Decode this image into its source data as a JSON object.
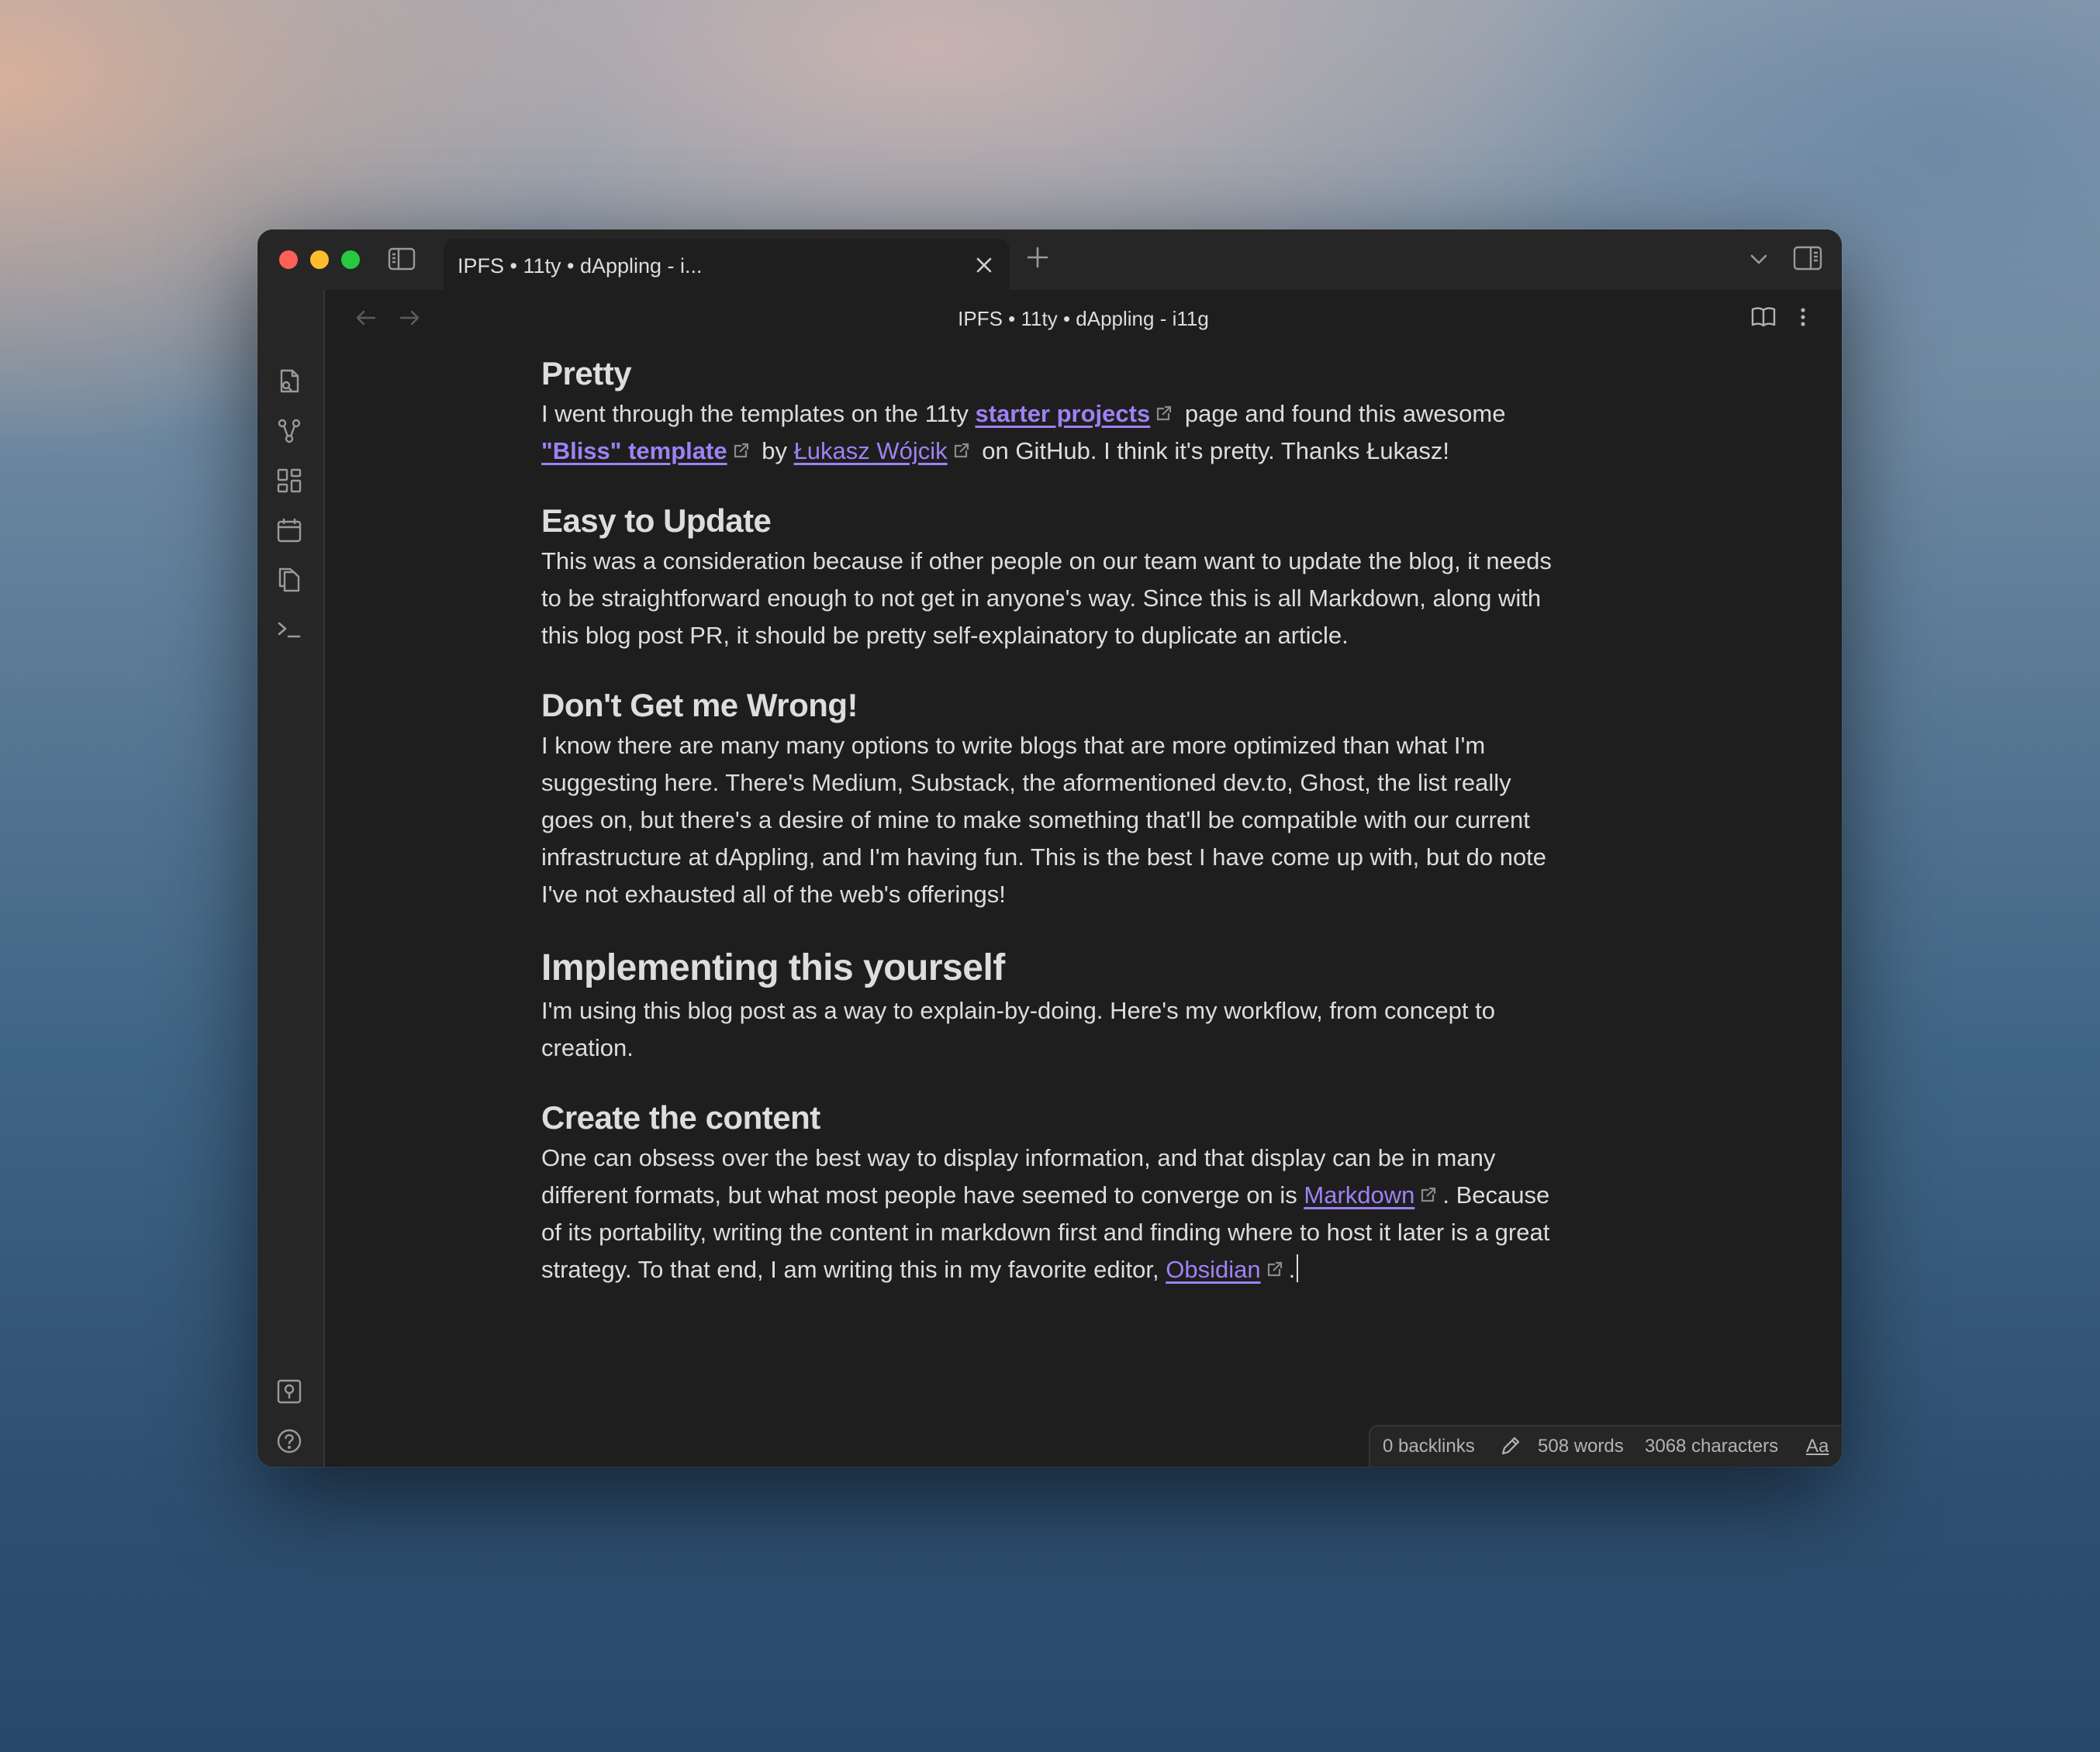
{
  "tab": {
    "title": "IPFS • 11ty • dAppling - i..."
  },
  "view": {
    "title": "IPFS • 11ty • dAppling - i11g"
  },
  "ribbon": {
    "top_icons": [
      "open-quick-switcher-icon",
      "graph-view-icon",
      "canvas-icon",
      "daily-notes-icon",
      "templates-icon",
      "command-palette-icon"
    ],
    "bottom_icons": [
      "vault-switcher-icon",
      "help-icon",
      "settings-icon"
    ]
  },
  "content": {
    "pretty": {
      "heading": "Pretty",
      "t1": "I went through the templates on the 11ty ",
      "link1": "starter projects",
      "t2": " page and found this awesome",
      "link2": "\"Bliss\" template",
      "t3": " by ",
      "link3": "Łukasz Wójcik",
      "t4": " on GitHub. I think it's pretty. Thanks Łukasz!"
    },
    "update": {
      "heading": "Easy to Update",
      "line1": "This was a consideration because if other people on our team want to update the blog, it needs",
      "line2": "to be straightforward enough to not get in anyone's way. Since this is all Markdown, along with",
      "line3": "this blog post PR, it should be pretty self-explainatory to duplicate an article."
    },
    "wrong": {
      "heading": "Don't Get me Wrong!",
      "line1": "I know there are many many options to write blogs that are more optimized than what I'm",
      "line2": "suggesting here. There's Medium, Substack, the aformentioned dev.to, Ghost, the list really",
      "line3": "goes on, but there's a desire of mine to make something that'll be compatible with our current",
      "line4": "infrastructure at dAppling, and I'm having fun. This is the best I have come up with, but do note",
      "line5": "I've not exhausted all of the web's offerings!"
    },
    "implement": {
      "heading": "Implementing this yourself",
      "line1": "I'm using this blog post as a way to explain-by-doing. Here's my workflow, from concept to",
      "line2": "creation."
    },
    "create": {
      "heading": "Create the content",
      "line1": "One can obsess over the best way to display information, and that display can be in many",
      "line2a": "different formats, but what most people have seemed to converge on is ",
      "link_markdown": "Markdown",
      "line2b": ". Because",
      "line3": "of its portability, writing the content in markdown first and finding where to host it later is a great",
      "line4a": "strategy. To that end, I am writing this in my favorite editor, ",
      "link_obsidian": "Obsidian",
      "line4b": "."
    }
  },
  "status": {
    "backlinks": "0 backlinks",
    "words": "508 words",
    "characters": "3068 characters",
    "font_toggle": "Aa"
  },
  "colors": {
    "link": "#9d82f5",
    "background": "#1e1e1e",
    "chrome": "#262626"
  }
}
